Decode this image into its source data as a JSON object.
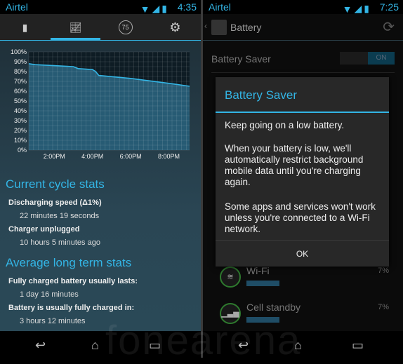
{
  "left": {
    "status": {
      "carrier": "Airtel",
      "time": "4:35"
    },
    "tabs": [
      {
        "icon": "battery-icon"
      },
      {
        "icon": "graph-icon"
      },
      {
        "icon": "cycle-75-icon",
        "label": "75"
      },
      {
        "icon": "settings-icon"
      }
    ],
    "selected_tab": 1,
    "sections": {
      "current_title": "Current cycle stats",
      "discharging_label": "Discharging speed (Δ1%)",
      "discharging_value": "22 minutes 19 seconds",
      "unplugged_label": "Charger unplugged",
      "unplugged_value": "10 hours 5 minutes ago",
      "average_title": "Average long term stats",
      "lasts_label": "Fully charged battery usually lasts:",
      "lasts_value": "1 day 16 minutes",
      "charged_label": "Battery is usually fully charged in:",
      "charged_value": "3 hours 12 minutes"
    }
  },
  "chart_data": {
    "type": "area",
    "y_ticks": [
      "100%",
      "90%",
      "80%",
      "70%",
      "60%",
      "50%",
      "40%",
      "30%",
      "20%",
      "10%",
      "0%"
    ],
    "ylim": [
      0,
      100
    ],
    "x_ticks": [
      "2:00PM",
      "4:00PM",
      "6:00PM",
      "8:00PM"
    ],
    "xlim": [
      "12:40",
      "21:05"
    ],
    "grid": true,
    "points": [
      [
        "12:40",
        88
      ],
      [
        "13:00",
        87
      ],
      [
        "14:00",
        86
      ],
      [
        "15:00",
        85
      ],
      [
        "15:15",
        83
      ],
      [
        "16:00",
        82
      ],
      [
        "16:10",
        80
      ],
      [
        "16:20",
        76
      ],
      [
        "18:00",
        73
      ],
      [
        "20:00",
        68
      ],
      [
        "21:05",
        65
      ]
    ],
    "color": "#33b5e5"
  },
  "right": {
    "status": {
      "carrier": "Airtel",
      "time": "7:25"
    },
    "title": "Battery",
    "saver_label": "Battery Saver",
    "toggle": "ON",
    "dialog": {
      "title": "Battery Saver",
      "p1": "Keep going on a low battery.",
      "p2": "When your battery is low, we'll automatically restrict background mobile data until you're charging again.",
      "p3": "Some apps and services won't work unless you're connected to a Wi-Fi network.",
      "ok": "OK"
    },
    "usage": [
      {
        "name": "Wi-Fi",
        "percent": "7%"
      },
      {
        "name": "Cell standby",
        "percent": "7%"
      }
    ]
  },
  "watermark": "fonearena"
}
